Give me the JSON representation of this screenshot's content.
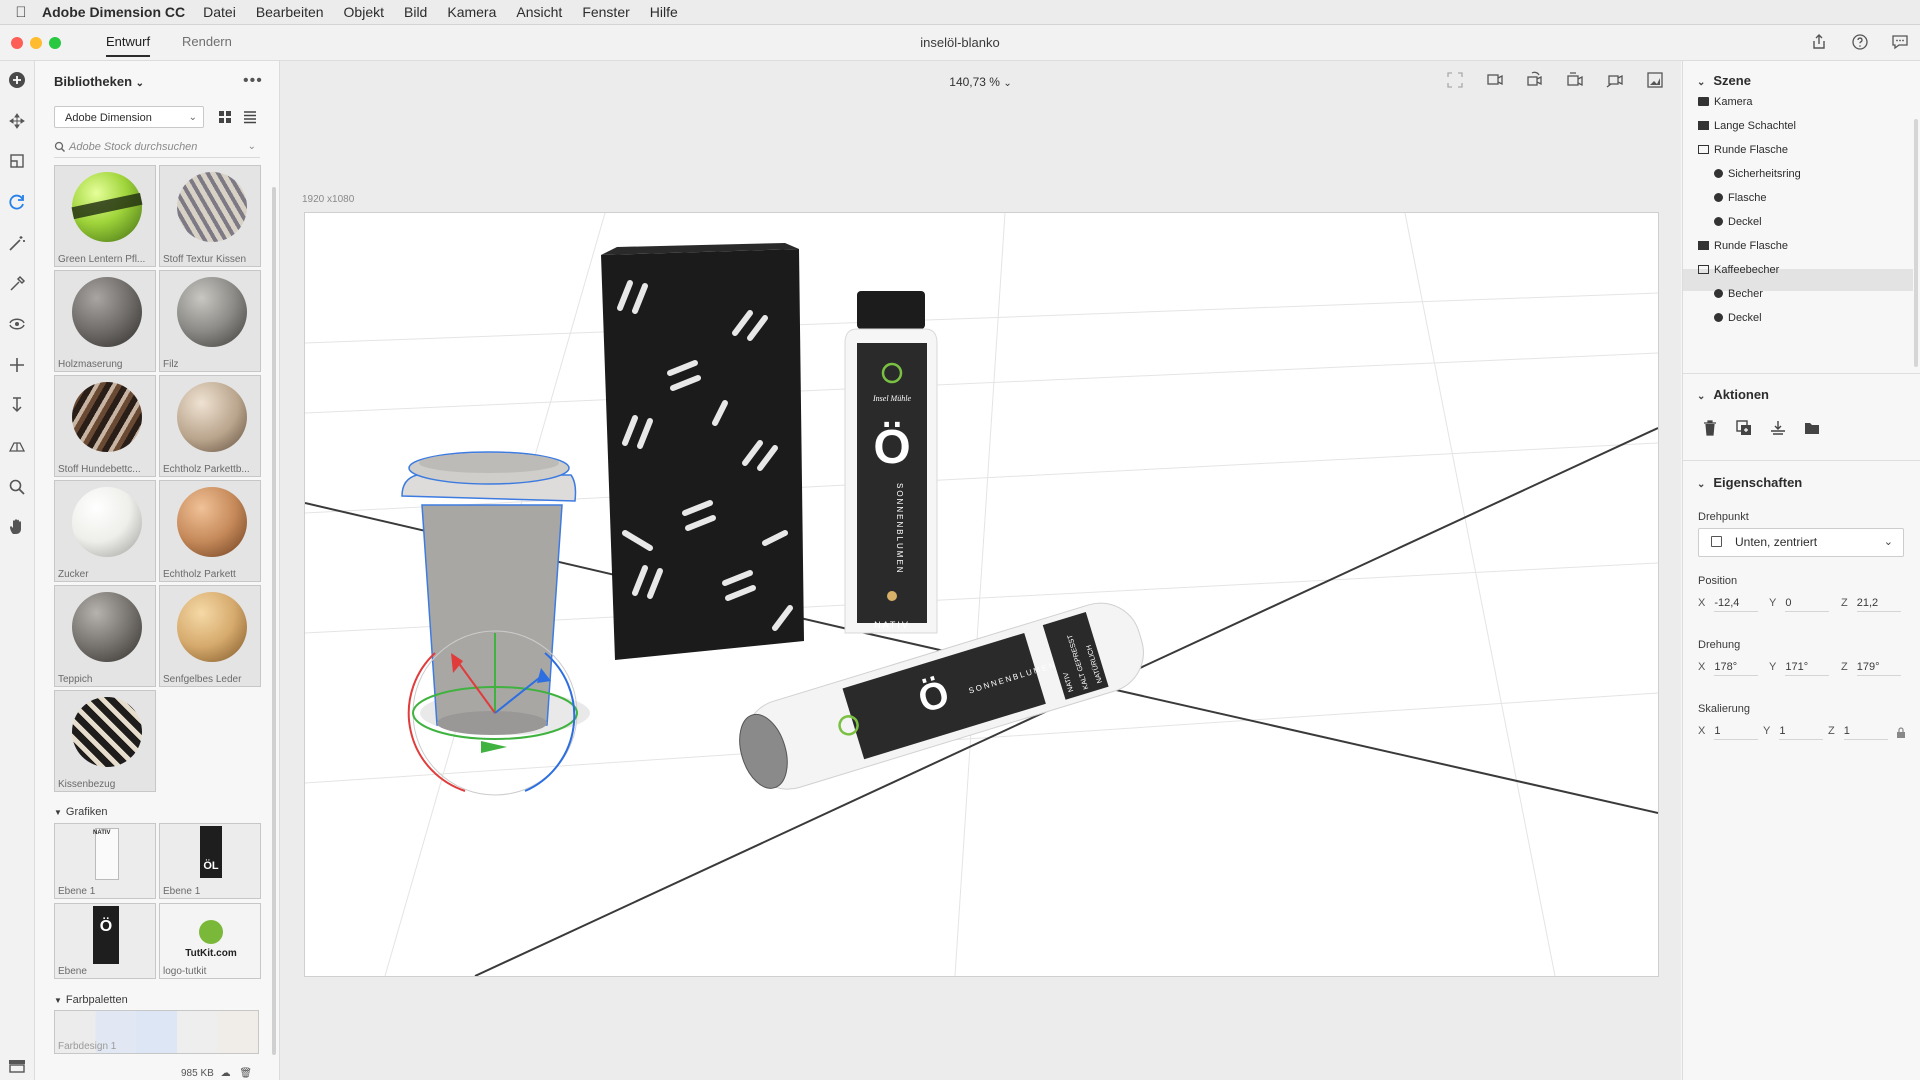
{
  "menubar": {
    "app_name": "Adobe Dimension CC",
    "items": [
      "Datei",
      "Bearbeiten",
      "Objekt",
      "Bild",
      "Kamera",
      "Ansicht",
      "Fenster",
      "Hilfe"
    ]
  },
  "titlebar": {
    "tabs": [
      "Entwurf",
      "Rendern"
    ],
    "active_tab": "Entwurf",
    "document_title": "inselöl-blanko"
  },
  "libraries": {
    "title": "Bibliotheken",
    "more": "•••",
    "library_select": "Adobe Dimension",
    "search_placeholder": "Adobe Stock durchsuchen",
    "materials": [
      {
        "label": "Green Lentern Pfl...",
        "color": "#9fd43a"
      },
      {
        "label": "Stoff Textur Kissen",
        "color": "#b8b4ad"
      },
      {
        "label": "Holzmaserung",
        "color": "#6f6c69"
      },
      {
        "label": "Filz",
        "color": "#8c8a86"
      },
      {
        "label": "Stoff Hundebettc...",
        "color": "#4b3a2e"
      },
      {
        "label": "Echtholz Parkettb...",
        "color": "#b9a48c"
      },
      {
        "label": "Zucker",
        "color": "#eeeeea"
      },
      {
        "label": "Echtholz Parkett",
        "color": "#c68a5a"
      },
      {
        "label": "Teppich",
        "color": "#77736f"
      },
      {
        "label": "Senfgelbes Leder",
        "color": "#d6aa6d"
      },
      {
        "label": "Kissenbezug",
        "color": "#3a3735"
      }
    ],
    "graphics_header": "Grafiken",
    "graphics": [
      {
        "label": "Ebene 1",
        "text": "NATIV"
      },
      {
        "label": "Ebene 1",
        "text": "ÖL"
      },
      {
        "label": "Ebene",
        "text": "Ö"
      },
      {
        "label": "logo-tutkit",
        "text": "TutKit.com"
      }
    ],
    "palettes_header": "Farbpaletten",
    "palette_label": "Farbdesign 1",
    "size": "985 KB"
  },
  "canvas": {
    "zoom": "140,73 %",
    "canvas_size": "1920 x1080",
    "bottle_brand": "Insel Mühle",
    "bottle_letter": "Ö",
    "bottle_vertical": "SONNENBLUMEN",
    "bottle_label": "NATIV",
    "lying_vertical1": "NATIV",
    "lying_vertical2": "KALT GEPRESST",
    "lying_vertical3": "NATÜRLICH"
  },
  "scene": {
    "header": "Szene",
    "items": [
      {
        "label": "Kamera",
        "indent": 0,
        "icon": "camera-icon"
      },
      {
        "label": "Lange Schachtel",
        "indent": 0,
        "icon": "folder-icon"
      },
      {
        "label": "Runde Flasche",
        "indent": 0,
        "icon": "folder-open-icon"
      },
      {
        "label": "Sicherheitsring",
        "indent": 1,
        "icon": "object-icon"
      },
      {
        "label": "Flasche",
        "indent": 1,
        "icon": "object-icon"
      },
      {
        "label": "Deckel",
        "indent": 1,
        "icon": "object-icon"
      },
      {
        "label": "Runde Flasche",
        "indent": 0,
        "icon": "folder-icon"
      },
      {
        "label": "Kaffeebecher",
        "indent": 0,
        "icon": "folder-open-icon"
      },
      {
        "label": "Becher",
        "indent": 1,
        "icon": "object-icon"
      },
      {
        "label": "Deckel",
        "indent": 1,
        "icon": "object-icon"
      }
    ],
    "selected": "Kaffeebecher"
  },
  "actions": {
    "header": "Aktionen",
    "icons": [
      "trash-icon",
      "duplicate-icon",
      "drop-icon",
      "group-folder-icon"
    ]
  },
  "properties": {
    "header": "Eigenschaften",
    "pivot_label": "Drehpunkt",
    "pivot_value": "Unten, zentriert",
    "position_label": "Position",
    "position": {
      "x": "-12,4",
      "y": "0",
      "z": "21,2"
    },
    "rotation_label": "Drehung",
    "rotation": {
      "x": "178°",
      "y": "171°",
      "z": "179°"
    },
    "scale_label": "Skalierung",
    "scale": {
      "x": "1",
      "y": "1",
      "z": "1"
    },
    "axis_x": "X",
    "axis_y": "Y",
    "axis_z": "Z"
  },
  "colors": {
    "accent": "#2680eb",
    "gizmo_red": "#e03c3c",
    "gizmo_green": "#3fb23f",
    "gizmo_blue": "#2d6fe0"
  }
}
